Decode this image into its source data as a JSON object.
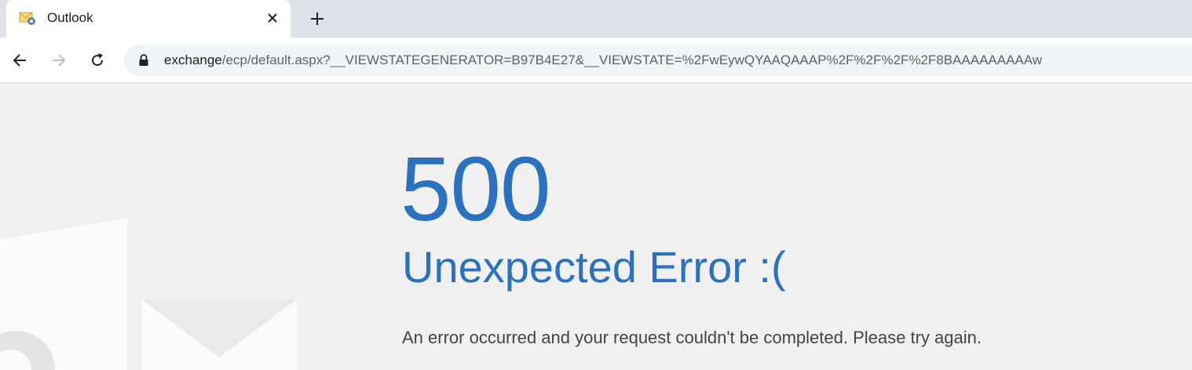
{
  "browser": {
    "tab": {
      "title": "Outlook",
      "favicon": "outlook-envelope-icon"
    },
    "url": {
      "host": "exchange",
      "path": "/ecp/default.aspx?__VIEWSTATEGENERATOR=B97B4E27&__VIEWSTATE=%2FwEywQYAAQAAAP%2F%2F%2F%2F8BAAAAAAAAAw"
    },
    "icons": {
      "close": "close-icon",
      "new_tab": "plus-icon",
      "back": "arrow-left-icon",
      "forward": "arrow-right-icon",
      "reload": "reload-icon",
      "lock": "lock-icon"
    }
  },
  "page": {
    "error_code": "500",
    "error_title": "Unexpected Error :(",
    "error_message": "An error occurred and your request couldn't be completed. Please try again."
  },
  "colors": {
    "accent": "#2a71c0",
    "background": "#f0f0f0",
    "tabstrip": "#dee1e6"
  }
}
